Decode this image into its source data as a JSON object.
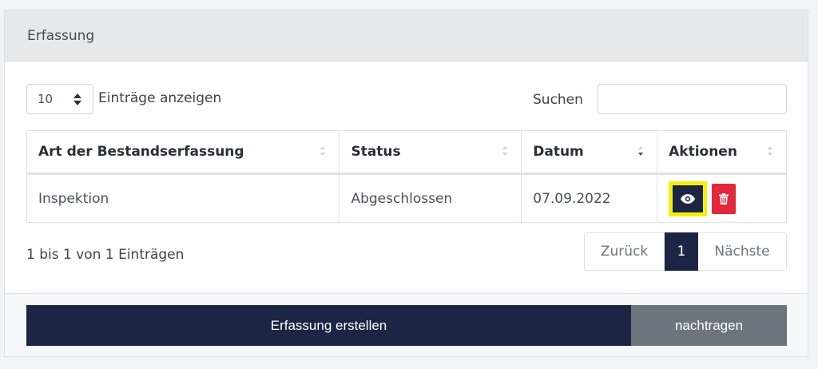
{
  "card": {
    "title": "Erfassung"
  },
  "controls": {
    "length_value": "10",
    "length_label": "Einträge anzeigen",
    "search_label": "Suchen",
    "search_value": ""
  },
  "table": {
    "headers": [
      "Art der Bestandserfassung",
      "Status",
      "Datum",
      "Aktionen"
    ],
    "rows": [
      {
        "art": "Inspektion",
        "status": "Abgeschlossen",
        "datum": "07.09.2022"
      }
    ]
  },
  "footer_info": "1 bis 1 von 1 Einträgen",
  "pagination": {
    "prev": "Zurück",
    "current": "1",
    "next": "Nächste"
  },
  "buttons": {
    "create": "Erfassung erstellen",
    "later": "nachtragen"
  },
  "icons": {
    "view": "eye-icon",
    "delete": "trash-icon"
  },
  "colors": {
    "primary": "#1c2544",
    "danger": "#e2283a",
    "secondary": "#6c757d",
    "highlight": "#f2f00c"
  }
}
